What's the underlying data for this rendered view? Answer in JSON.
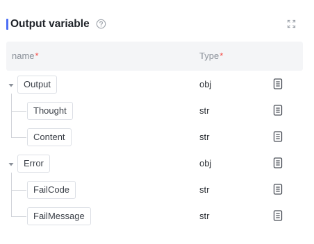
{
  "header": {
    "title": "Output variable",
    "help_icon": "question-circle-icon",
    "expand_icon": "expand-icon"
  },
  "table": {
    "columns": {
      "name": "name",
      "type": "Type",
      "required_mark": "*"
    },
    "rows": [
      {
        "name": "Output",
        "type": "obj",
        "level": 0,
        "expanded": true
      },
      {
        "name": "Thought",
        "type": "str",
        "level": 1
      },
      {
        "name": "Content",
        "type": "str",
        "level": 1
      },
      {
        "name": "Error",
        "type": "obj",
        "level": 0,
        "expanded": true
      },
      {
        "name": "FailCode",
        "type": "str",
        "level": 1
      },
      {
        "name": "FailMessage",
        "type": "str",
        "level": 1
      }
    ],
    "row_action_icon": "document-icon"
  },
  "colors": {
    "accent": "#4c6ef5",
    "required": "#f54a45",
    "header_bg": "#f4f5f7"
  }
}
